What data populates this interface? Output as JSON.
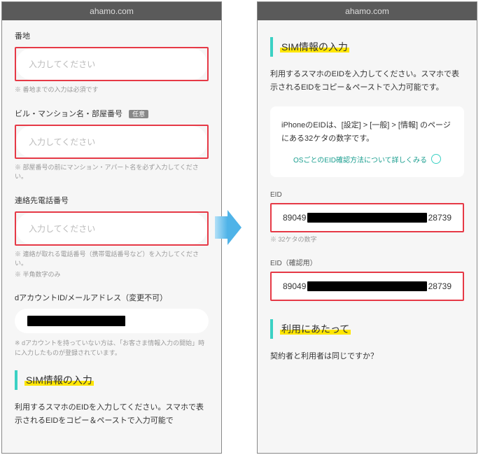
{
  "urlbar": "ahamo.com",
  "left": {
    "f1_label": "番地",
    "f1_placeholder": "入力してください",
    "f1_help": "※ 番地までの入力は必須です",
    "f2_label": "ビル・マンション名・部屋番号",
    "f2_opt": "任意",
    "f2_placeholder": "入力してください",
    "f2_help": "※ 部屋番号の前にマンション・アパート名を必ず入力してください。",
    "f3_label": "連絡先電話番号",
    "f3_placeholder": "入力してください",
    "f3_help1": "※ 連絡が取れる電話番号（携帯電話番号など）を入力してください。",
    "f3_help2": "※ 半角数字のみ",
    "f4_label": "dアカウントID/メールアドレス（変更不可）",
    "f4_help": "※ dアカウントを持っていない方は、「お客さま情報入力の開始」時に入力したものが登録されています。",
    "sim_heading": "SIM情報の入力",
    "sim_desc": "利用するスマホのEIDを入力してください。スマホで表示されるEIDをコピー＆ペーストで入力可能で"
  },
  "right": {
    "sim_heading": "SIM情報の入力",
    "sim_desc": "利用するスマホのEIDを入力してください。スマホで表示されるEIDをコピー＆ペーストで入力可能です。",
    "info_line": "iPhoneのEIDは、[設定] > [一般] > [情報] のページにある32ケタの数字です。",
    "info_link": "OSごとのEID確認方法について詳しくみる",
    "eid_label": "EID",
    "eid_prefix": "89049",
    "eid_suffix": "28739",
    "eid_help": "※ 32ケタの数字",
    "eid2_label": "EID（確認用）",
    "usage_heading": "利用にあたって",
    "q1": "契約者と利用者は同じですか？"
  }
}
